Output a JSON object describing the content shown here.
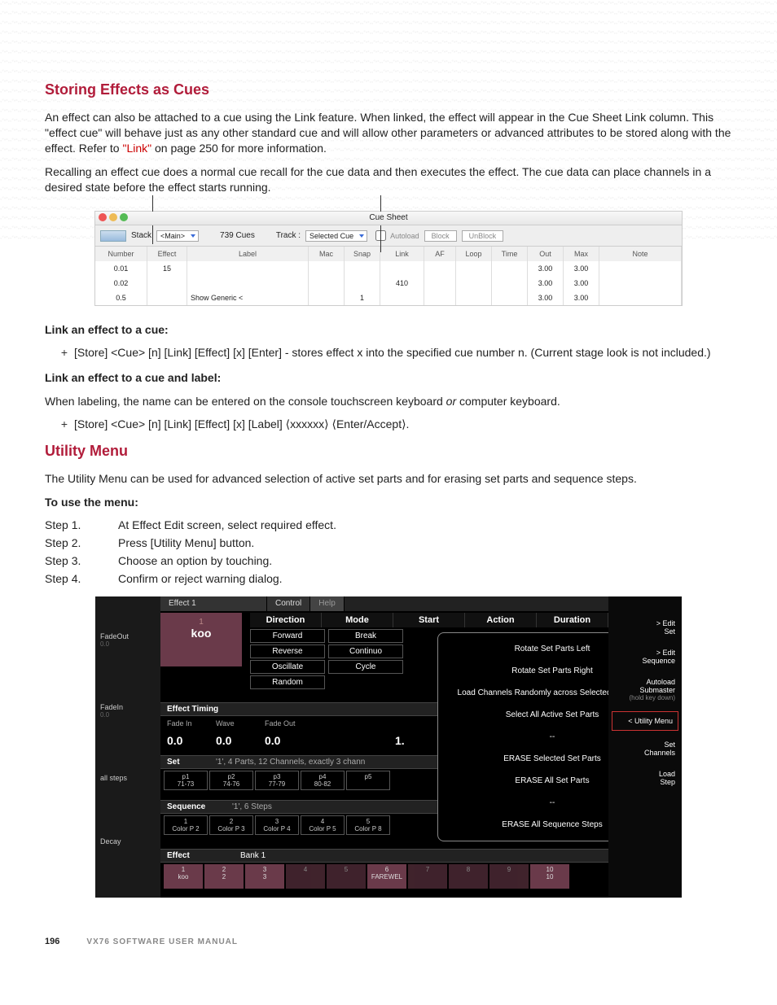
{
  "headings": {
    "h1": "Storing Effects as Cues",
    "h2": "Utility Menu"
  },
  "paragraphs": {
    "p1a": "An effect can also be attached to a cue using the Link feature. When linked, the effect will appear in the Cue Sheet Link column. This \"effect cue\" will behave just as any other standard cue and will allow other parameters or advanced attributes to be stored along with the effect. Refer to ",
    "p1_link": "\"Link\"",
    "p1b": " on page 250 for more information.",
    "p2": "Recalling an effect cue does a normal cue recall for the cue data and then executes the effect. The cue data can place channels in a desired state before the effect starts running.",
    "link_effect_title": "Link an effect to a cue:",
    "link_effect_item": "[Store] <Cue> [n] [Link] [Effect] [x] [Enter] - stores effect x into the specified cue number n. (Current stage look is not included.)",
    "link_label_title": "Link an effect to a cue and label:",
    "link_label_desc_a": "When labeling, the name can be entered on the console touchscreen keyboard ",
    "link_label_desc_or": "or",
    "link_label_desc_b": " computer keyboard.",
    "link_label_item": "[Store] <Cue> [n] [Link] [Effect] [x] [Label] ⟨xxxxxx⟩ ⟨Enter/Accept⟩.",
    "utility_desc": "The Utility Menu can be used for advanced selection of active set parts and for erasing set parts and sequence steps.",
    "use_menu_title": "To use the menu:"
  },
  "steps": [
    {
      "n": "Step   1.",
      "t": "At Effect Edit screen, select required effect."
    },
    {
      "n": "Step   2.",
      "t": "Press [Utility Menu] button."
    },
    {
      "n": "Step   3.",
      "t": "Choose an option by touching."
    },
    {
      "n": "Step   4.",
      "t": "Confirm or reject warning dialog."
    }
  ],
  "footer": {
    "page": "196",
    "manual": "VX76 SOFTWARE USER MANUAL"
  },
  "cueSheet": {
    "title": "Cue Sheet",
    "toolbar": {
      "stack": "Stack",
      "main": "<Main>",
      "count": "739 Cues",
      "track": "Track :",
      "selected": "Selected Cue",
      "autoload": "Autoload",
      "block": "Block",
      "unblock": "UnBlock"
    },
    "headers": [
      "Number",
      "Effect",
      "Label",
      "Mac",
      "Snap",
      "Link",
      "AF",
      "Loop",
      "Time",
      "Out",
      "Max",
      "Note"
    ],
    "rows": [
      {
        "num": "0.01",
        "effect": "15",
        "label": "",
        "mac": "",
        "snap": "",
        "link": "",
        "af": "",
        "loop": "",
        "time": "",
        "out": "3.00",
        "max": "3.00",
        "note": ""
      },
      {
        "num": "0.02",
        "effect": "",
        "label": "",
        "mac": "",
        "snap": "",
        "link": "410",
        "af": "",
        "loop": "",
        "time": "",
        "out": "3.00",
        "max": "3.00",
        "note": ""
      },
      {
        "num": "0.5",
        "effect": "",
        "label": "Show Generic <",
        "mac": "",
        "snap": "1",
        "link": "",
        "af": "",
        "loop": "",
        "time": "",
        "out": "3.00",
        "max": "3.00",
        "note": ""
      }
    ]
  },
  "fx": {
    "title": "Effect 1",
    "tabs": {
      "control": "Control",
      "help": "Help"
    },
    "tile": {
      "num": "1",
      "name": "koo"
    },
    "left": [
      {
        "label": "FadeOut",
        "val": "0.0"
      },
      {
        "label": "FadeIn",
        "val": "0.0"
      },
      {
        "label": "all steps",
        "val": ""
      },
      {
        "label": "Decay",
        "val": ""
      }
    ],
    "headers": [
      "Direction",
      "Mode",
      "Start",
      "Action",
      "Duration"
    ],
    "direction": [
      "Forward",
      "Reverse",
      "Oscillate",
      "Random"
    ],
    "mode": [
      "Break",
      "Continuo",
      "Cycle"
    ],
    "timing": {
      "title": "Effect Timing",
      "cols": [
        "Fade In",
        "Wave",
        "Fade Out"
      ],
      "vals": [
        "0.0",
        "0.0",
        "0.0"
      ],
      "extra": "1."
    },
    "set": {
      "title": "Set",
      "desc": "'1', 4 Parts, 12 Channels, exactly 3 chann",
      "parts": [
        {
          "n": "p1",
          "r": "71-73"
        },
        {
          "n": "p2",
          "r": "74-76"
        },
        {
          "n": "p3",
          "r": "77-79"
        },
        {
          "n": "p4",
          "r": "80-82"
        },
        {
          "n": "p5",
          "r": ""
        }
      ]
    },
    "seq": {
      "title": "Sequence",
      "desc": "'1', 6 Steps",
      "steps": [
        {
          "n": "1",
          "l": "Color P 2"
        },
        {
          "n": "2",
          "l": "Color P 3"
        },
        {
          "n": "3",
          "l": "Color P 4"
        },
        {
          "n": "4",
          "l": "Color P 5"
        },
        {
          "n": "5",
          "l": "Color P 8"
        }
      ]
    },
    "effectRow": {
      "title": "Effect",
      "bank": "Bank 1"
    },
    "bank": [
      {
        "n": "1",
        "l": "koo"
      },
      {
        "n": "2",
        "l": "2"
      },
      {
        "n": "3",
        "l": "3"
      },
      {
        "n": "4",
        "l": ""
      },
      {
        "n": "5",
        "l": ""
      },
      {
        "n": "6",
        "l": "FAREWEL"
      },
      {
        "n": "7",
        "l": ""
      },
      {
        "n": "8",
        "l": ""
      },
      {
        "n": "9",
        "l": ""
      },
      {
        "n": "10",
        "l": "10"
      }
    ],
    "menu": [
      "Rotate Set Parts Left",
      "Rotate Set Parts Right",
      "Load Channels Randomly across Selected Set Parts",
      "Select All Active Set Parts",
      "--",
      "ERASE Selected Set Parts",
      "ERASE All Set Parts",
      "--",
      "ERASE All Sequence Steps"
    ],
    "right": [
      {
        "l": "> Edit\nSet"
      },
      {
        "l": "> Edit\nSequence"
      },
      {
        "l": "Autoload\nSubmaster",
        "sub": "(hold key down)"
      },
      {
        "l": "< Utility Menu",
        "hl": true
      },
      {
        "l": "Set\nChannels"
      },
      {
        "l": "Load\nStep"
      }
    ]
  }
}
